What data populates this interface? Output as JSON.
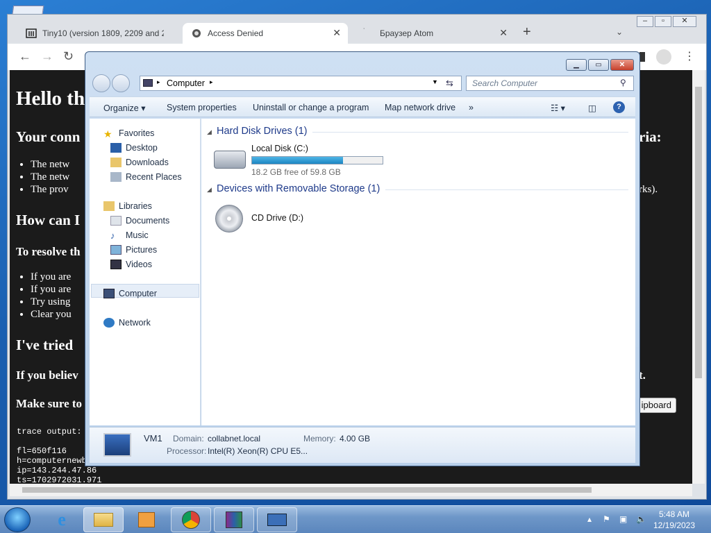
{
  "browser": {
    "tabs": [
      {
        "title": "Tiny10 (version 1809, 2209 and 2"
      },
      {
        "title": "Access Denied"
      },
      {
        "title": "Браузер Atom"
      }
    ],
    "new_tab": "+",
    "page": {
      "heading": "Hello th",
      "connection_heading": "Your conn",
      "connection_heading_end": "ria:",
      "reasons": [
        "The netw",
        "The netw",
        "The prov"
      ],
      "reasons_tail": "rks).",
      "how_heading": "How can I",
      "resolve_heading": "To resolve th",
      "steps": [
        "If you are",
        "If you are",
        "Try using",
        "Clear you"
      ],
      "tried_heading": "I've tried",
      "believe_heading": "If you believ",
      "believe_end": "t.",
      "make_sure_heading": "Make sure to",
      "clipboard_button": "ipboard",
      "trace": [
        "trace output:",
        "",
        "fl=650f116",
        "h=computernewb",
        "ip=143.244.47.86",
        "ts=1702972031.971"
      ]
    }
  },
  "explorer": {
    "address": [
      "Computer"
    ],
    "search_placeholder": "Search Computer",
    "commands": [
      "Organize",
      "System properties",
      "Uninstall or change a program",
      "Map network drive",
      "»"
    ],
    "nav": {
      "favorites": "Favorites",
      "favorites_items": [
        "Desktop",
        "Downloads",
        "Recent Places"
      ],
      "libraries": "Libraries",
      "libraries_items": [
        "Documents",
        "Music",
        "Pictures",
        "Videos"
      ],
      "computer": "Computer",
      "network": "Network"
    },
    "groups": {
      "hdd": "Hard Disk Drives (1)",
      "removable": "Devices with Removable Storage (1)"
    },
    "local_disk": {
      "name": "Local Disk (C:)",
      "free": "18.2 GB free of 59.8 GB",
      "used_fraction": 0.696
    },
    "cd_drive": {
      "name": "CD Drive (D:)"
    },
    "details": {
      "name": "VM1",
      "domain_label": "Domain:",
      "domain": "collabnet.local",
      "memory_label": "Memory:",
      "memory": "4.00 GB",
      "processor_label": "Processor:",
      "processor": "Intel(R) Xeon(R) CPU E5..."
    }
  },
  "taskbar": {
    "time": "5:48 AM",
    "date": "12/19/2023"
  }
}
